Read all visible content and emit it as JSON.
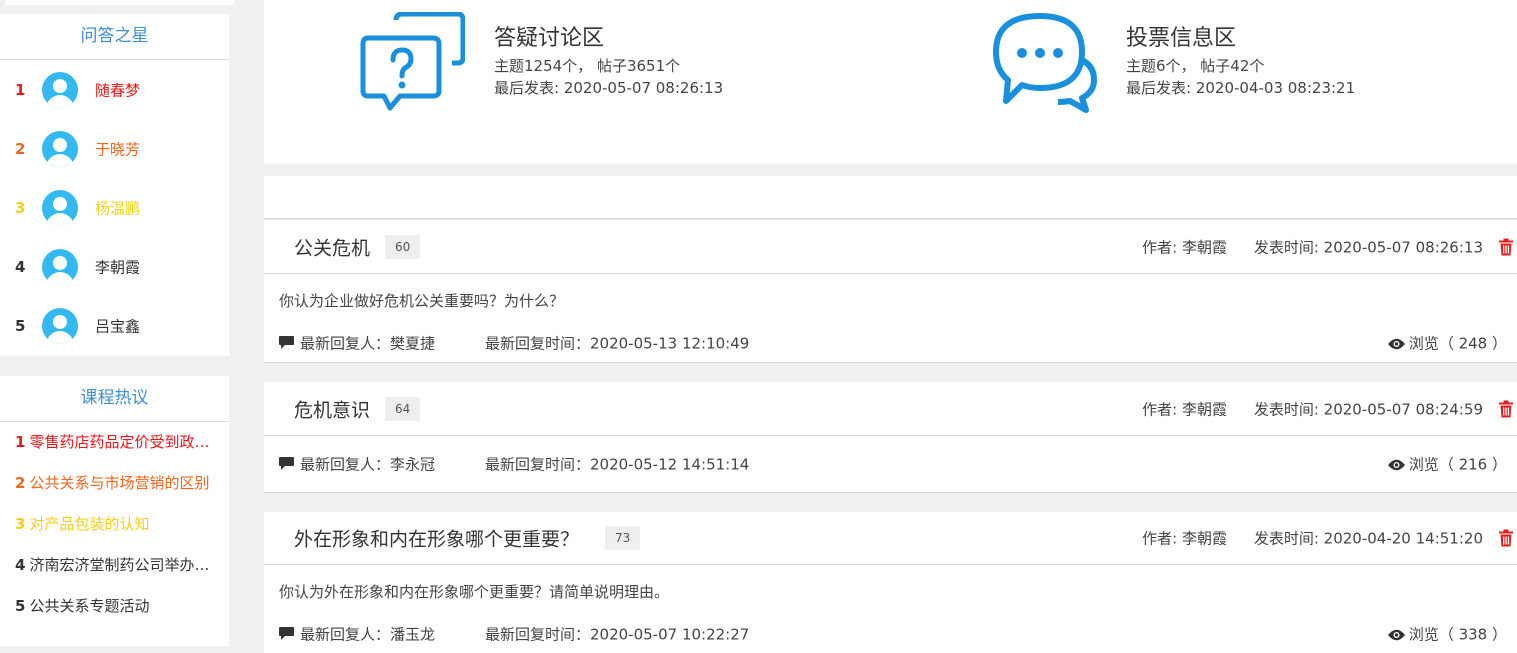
{
  "sidebar": {
    "stars": {
      "title": "问答之星",
      "items": [
        {
          "rank": "1",
          "name": "随春梦",
          "color": "#e81818"
        },
        {
          "rank": "2",
          "name": "于晓芳",
          "color": "#f0661a"
        },
        {
          "rank": "3",
          "name": "杨温鹏",
          "color": "#f5cf1e"
        },
        {
          "rank": "4",
          "name": "李朝霞",
          "color": "#333333"
        },
        {
          "rank": "5",
          "name": "吕宝鑫",
          "color": "#333333"
        }
      ]
    },
    "hot": {
      "title": "课程热议",
      "items": [
        {
          "rank": "1",
          "title": "零售药店药品定价受到政府管控吗",
          "color": "#e81818"
        },
        {
          "rank": "2",
          "title": "公共关系与市场营销的区别",
          "color": "#f0661a"
        },
        {
          "rank": "3",
          "title": "对产品包装的认知",
          "color": "#f5cf1e"
        },
        {
          "rank": "4",
          "title": "济南宏济堂制药公司举办活动",
          "color": "#333333"
        },
        {
          "rank": "5",
          "title": "公共关系专题活动",
          "color": "#333333"
        }
      ]
    }
  },
  "forums": [
    {
      "icon": "question-bubbles-icon",
      "title": "答疑讨论区",
      "stats": "主题1254个， 帖子3651个",
      "last": "最后发表: 2020-05-07 08:26:13"
    },
    {
      "icon": "chat-bubbles-icon",
      "title": "投票信息区",
      "stats": "主题6个， 帖子42个",
      "last": "最后发表: 2020-04-03 08:23:21"
    }
  ],
  "posts": [
    {
      "title": "公关危机",
      "count": "60",
      "author": "作者: 李朝霞",
      "time": "发表时间: 2020-05-07 08:26:13",
      "body": "你认为企业做好危机公关重要吗？为什么？",
      "reply_user": "最新回复人：樊夏捷",
      "reply_time": "最新回复时间：2020-05-13 12:10:49",
      "views": "浏览（ 248 ）"
    },
    {
      "title": "危机意识",
      "count": "64",
      "author": "作者: 李朝霞",
      "time": "发表时间: 2020-05-07 08:24:59",
      "body": "",
      "reply_user": "最新回复人：李永冠",
      "reply_time": "最新回复时间：2020-05-12 14:51:14",
      "views": "浏览（ 216 ）"
    },
    {
      "title": "外在形象和内在形象哪个更重要？",
      "count": "73",
      "author": "作者: 李朝霞",
      "time": "发表时间: 2020-04-20 14:51:20",
      "body": "你认为外在形象和内在形象哪个更重要？请简单说明理由。",
      "reply_user": "最新回复人：潘玉龙",
      "reply_time": "最新回复时间：2020-05-07 10:22:27",
      "views": "浏览（ 338 ）"
    }
  ],
  "colors": {
    "accent": "#3d8fd6",
    "icon_blue": "#1a8fdc",
    "delete_red": "#e02020"
  }
}
